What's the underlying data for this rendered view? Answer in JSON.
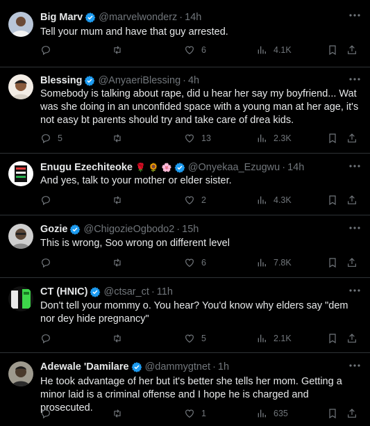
{
  "tweets": [
    {
      "name": "Big Marv",
      "handle": "@marvelwonderz",
      "time": "14h",
      "emojis": [],
      "text": "Tell your mum and have that guy arrested.",
      "replies": "",
      "retweets": "",
      "likes": "6",
      "views": "4.1K"
    },
    {
      "name": "Blessing",
      "handle": "@AnyaeriBlessing",
      "time": "4h",
      "emojis": [],
      "text": "Somebody is talking about rape, did u hear her say my boyfriend... Wat was she doing in an unconfided space with a young man at her age, it's not easy bt parents should try and take care of drea kids.",
      "replies": "5",
      "retweets": "",
      "likes": "13",
      "views": "2.3K"
    },
    {
      "name": "Enugu Ezechiteoke",
      "handle": "@Onyekaa_Ezugwu",
      "time": "14h",
      "emojis": [
        "🌹",
        "🌻",
        "🌸"
      ],
      "text": "And yes, talk to your mother or elder sister.",
      "replies": "",
      "retweets": "",
      "likes": "2",
      "views": "4.3K"
    },
    {
      "name": "Gozie",
      "handle": "@ChigozieOgbodo2",
      "time": "15h",
      "emojis": [],
      "text": "This is wrong, Soo wrong on different level",
      "replies": "",
      "retweets": "",
      "likes": "6",
      "views": "7.8K"
    },
    {
      "name": "CT (HNIC)",
      "handle": "@ctsar_ct",
      "time": "11h",
      "emojis": [],
      "text": "Don't tell your mommy o. You hear? You'd know why elders say \"dem nor dey hide pregnancy\"",
      "replies": "",
      "retweets": "",
      "likes": "5",
      "views": "2.1K"
    },
    {
      "name": "Adewale 'Damilare",
      "handle": "@dammygtnet",
      "time": "1h",
      "emojis": [],
      "text": "He took advantage of her but it's better she tells her mom. Getting a minor laid is a criminal offense and I hope he is charged and prosecuted.",
      "replies": "",
      "retweets": "",
      "likes": "1",
      "views": "635"
    }
  ],
  "separator": "·",
  "colors": {
    "background": "#000000",
    "text": "#e7e9ea",
    "muted": "#71767b",
    "verified": "#1d9bf0",
    "border": "#2f3336"
  }
}
